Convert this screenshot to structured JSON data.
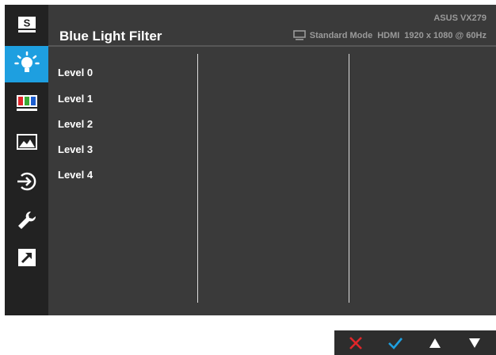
{
  "osd": {
    "title": "Blue Light Filter",
    "model": "ASUS VX279",
    "status": {
      "mode": "Standard Mode",
      "input": "HDMI",
      "resolution": "1920 x 1080 @ 60Hz"
    },
    "levels": [
      "Level 0",
      "Level 1",
      "Level 2",
      "Level 3",
      "Level 4"
    ]
  },
  "sidebar": {
    "items": [
      {
        "icon": "splendid-icon",
        "glyph": "S"
      },
      {
        "icon": "blue-light-filter-icon",
        "active": true
      },
      {
        "icon": "color-icon"
      },
      {
        "icon": "image-icon"
      },
      {
        "icon": "input-select-icon"
      },
      {
        "icon": "system-setup-icon"
      },
      {
        "icon": "shortcut-icon"
      }
    ]
  },
  "nav_buttons": [
    "close-icon",
    "confirm-icon",
    "up-arrow-icon",
    "down-arrow-icon"
  ],
  "colors": {
    "accent": "#1e9fe0",
    "panel": "#3a3a3a",
    "sidebar": "#222222",
    "close": "#e0262a",
    "confirm": "#1e9fe0"
  }
}
